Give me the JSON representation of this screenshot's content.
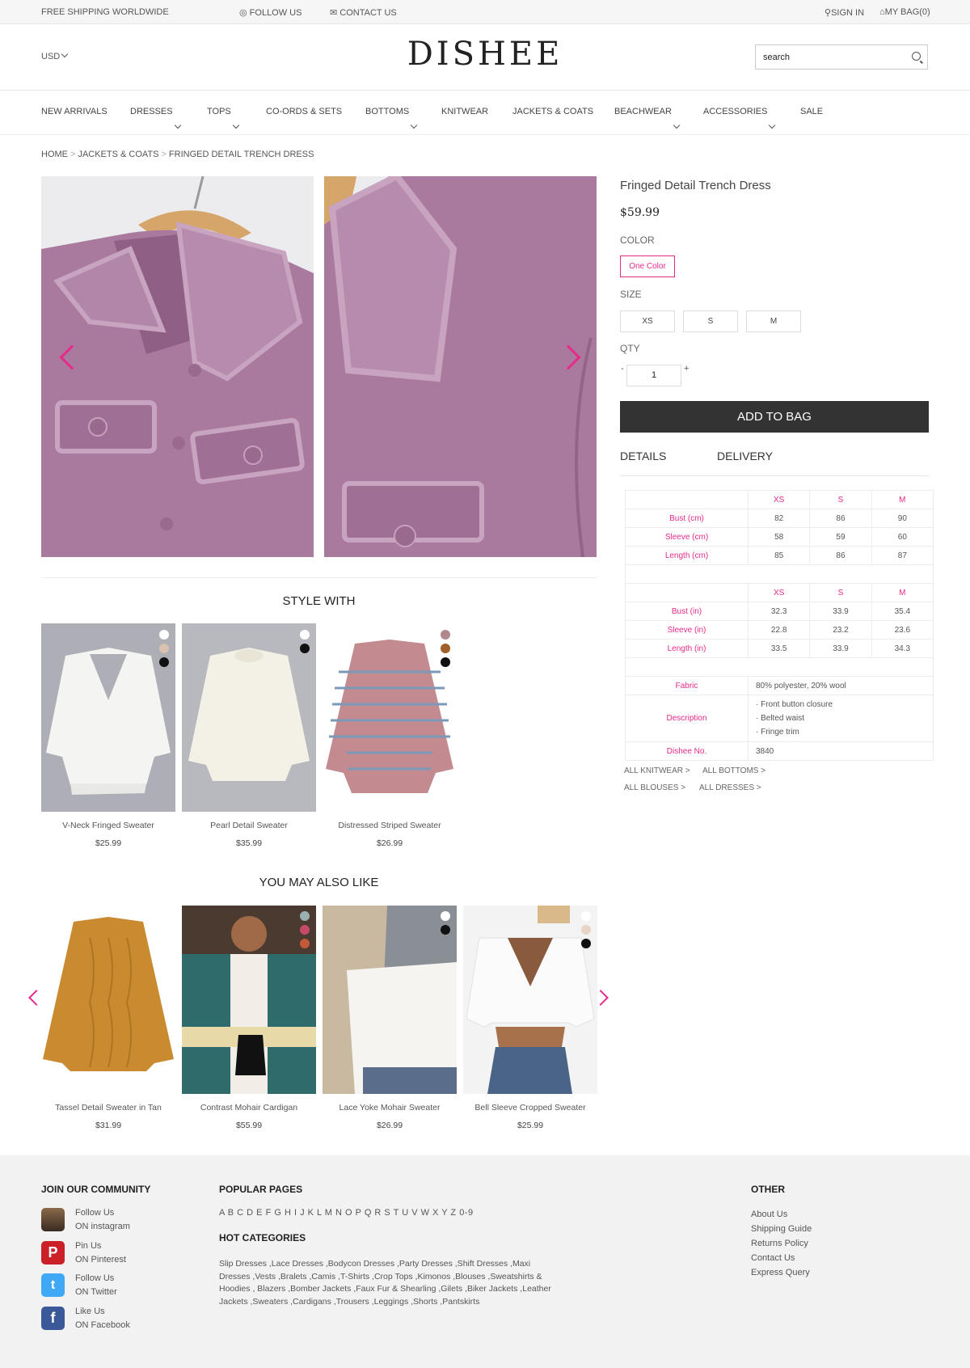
{
  "topbar": {
    "shipping": "FREE SHIPPING WORLDWIDE",
    "follow": "FOLLOW US",
    "contact": "CONTACT US",
    "signin": "SIGN IN",
    "bag": "MY BAG(0)"
  },
  "header": {
    "logo": "DISHEE",
    "currency": "USD",
    "search_placeholder": "search"
  },
  "nav": [
    "NEW ARRIVALS",
    "DRESSES",
    "TOPS",
    "CO-ORDS & SETS",
    "BOTTOMS",
    "KNITWEAR",
    "JACKETS & COATS",
    "BEACHWEAR",
    "ACCESSORIES",
    "SALE"
  ],
  "breadcrumb": [
    "HOME",
    "JACKETS & COATS",
    "FRINGED DETAIL TRENCH DRESS"
  ],
  "product": {
    "title": "Fringed Detail Trench Dress",
    "price": "$59.99",
    "color_label": "COLOR",
    "color_option": "One Color",
    "size_label": "SIZE",
    "sizes": [
      "XS",
      "S",
      "M"
    ],
    "qty_label": "QTY",
    "qty_minus": "-",
    "qty_value": "1",
    "qty_plus": "+",
    "add_to_bag": "ADD TO BAG",
    "tabs": [
      "DETAILS",
      "DELIVERY"
    ]
  },
  "size_chart": {
    "cm_header": [
      "XS",
      "S",
      "M"
    ],
    "cm_rows": [
      {
        "label": "Bust (cm)",
        "values": [
          "82",
          "86",
          "90"
        ]
      },
      {
        "label": "Sleeve (cm)",
        "values": [
          "58",
          "59",
          "60"
        ]
      },
      {
        "label": "Length (cm)",
        "values": [
          "85",
          "86",
          "87"
        ]
      }
    ],
    "in_header": [
      "XS",
      "S",
      "M"
    ],
    "in_rows": [
      {
        "label": "Bust (in)",
        "values": [
          "32.3",
          "33.9",
          "35.4"
        ]
      },
      {
        "label": "Sleeve (in)",
        "values": [
          "22.8",
          "23.2",
          "23.6"
        ]
      },
      {
        "label": "Length (in)",
        "values": [
          "33.5",
          "33.9",
          "34.3"
        ]
      }
    ],
    "fabric_label": "Fabric",
    "fabric": "80% polyester, 20% wool",
    "description_label": "Description",
    "description": [
      "· Front button closure",
      "· Belted waist",
      "· Fringe trim"
    ],
    "number_label": "Dishee No.",
    "number": "3840"
  },
  "related_links": [
    "ALL KNITWEAR >",
    "ALL BOTTOMS >",
    "ALL BLOUSES >",
    "ALL DRESSES >"
  ],
  "style_with": {
    "title": "STYLE WITH",
    "items": [
      {
        "name": "V-Neck Fringed Sweater",
        "price": "$25.99",
        "colors": [
          "#ffffff",
          "#d9c2b0",
          "#111111"
        ]
      },
      {
        "name": "Pearl Detail Sweater",
        "price": "$35.99",
        "colors": [
          "#ffffff",
          "#111111"
        ]
      },
      {
        "name": "Distressed Striped Sweater",
        "price": "$26.99",
        "colors": [
          "#b08a8a",
          "#a0602a",
          "#111111"
        ]
      }
    ]
  },
  "may_like": {
    "title": "YOU MAY ALSO LIKE",
    "items": [
      {
        "name": "Tassel Detail Sweater in Tan",
        "price": "$31.99"
      },
      {
        "name": "Contrast Mohair Cardigan",
        "price": "$55.99",
        "colors": [
          "#9ab0ae",
          "#c44a6a",
          "#c25a3a"
        ]
      },
      {
        "name": "Lace Yoke Mohair Sweater",
        "price": "$26.99",
        "colors": [
          "#ffffff",
          "#111111"
        ]
      },
      {
        "name": "Bell Sleeve Cropped Sweater",
        "price": "$25.99",
        "colors": [
          "#ffffff",
          "#e9d4c8",
          "#111111"
        ]
      }
    ]
  },
  "footer": {
    "community_title": "JOIN OUR COMMUNITY",
    "social": [
      {
        "line1": "Follow Us",
        "line2": "ON instagram",
        "icon": "instagram-icon"
      },
      {
        "line1": "Pin Us",
        "line2": "ON Pinterest",
        "icon": "pinterest-icon"
      },
      {
        "line1": "Follow Us",
        "line2": "ON Twitter",
        "icon": "twitter-icon"
      },
      {
        "line1": "Like Us",
        "line2": "ON Facebook",
        "icon": "facebook-icon"
      }
    ],
    "popular_title": "POPULAR PAGES",
    "alphabet": "A B C D E F G H I J K L M N O P Q R S T U V W X Y Z 0-9",
    "hot_title": "HOT CATEGORIES",
    "hot_lines": [
      "Slip Dresses ,Lace Dresses ,Bodycon Dresses ,Party Dresses ,Shift Dresses ,Maxi",
      "Dresses ,Vests ,Bralets ,Camis ,T-Shirts ,Crop Tops ,Kimonos ,Blouses ,Sweatshirts &",
      "Hoodies , Blazers ,Bomber Jackets ,Faux Fur & Shearling ,Gilets ,Biker Jackets ,Leather",
      "Jackets ,Sweaters ,Cardigans ,Trousers ,Leggings ,Shorts ,Pantskirts"
    ],
    "other_title": "OTHER",
    "other_links": [
      "About Us",
      "Shipping Guide",
      "Returns Policy",
      "Contact Us",
      "Express Query"
    ]
  },
  "colors": {
    "accent": "#e52a8a",
    "button": "#333333",
    "jacket": "#a97a9e"
  }
}
